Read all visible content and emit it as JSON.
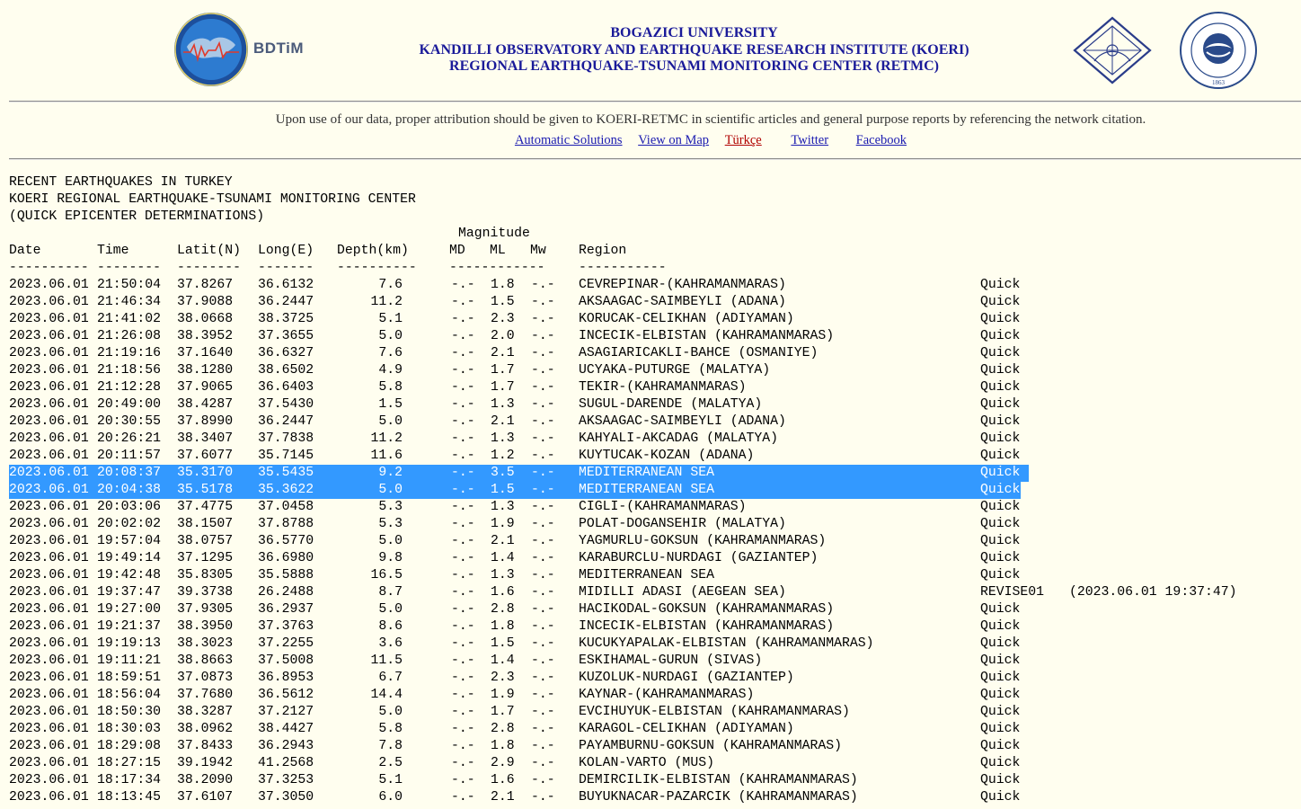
{
  "header": {
    "bdtim_label": "BDTiM",
    "title_line1": "BOGAZICI UNIVERSITY",
    "title_line2": "KANDILLI OBSERVATORY AND EARTHQUAKE RESEARCH INSTITUTE (KOERI)",
    "title_line3": "REGIONAL EARTHQUAKE-TSUNAMI MONITORING CENTER (RETMC)",
    "bu_logo_year": "1863"
  },
  "notice": "Upon use of our data, proper attribution should be given to KOERI-RETMC in scientific articles and general purpose reports by referencing the network citation.",
  "links": {
    "automatic": "Automatic Solutions",
    "map": "View on Map",
    "turkce": "Türkçe",
    "twitter": "Twitter",
    "facebook": "Facebook"
  },
  "listing": {
    "heading1": "RECENT EARTHQUAKES IN TURKEY",
    "heading2": "KOERI REGIONAL EARTHQUAKE-TSUNAMI MONITORING CENTER",
    "heading3": "(QUICK EPICENTER DETERMINATIONS)",
    "magnitude_label": "Magnitude",
    "columns": {
      "date": "Date",
      "time": "Time",
      "lat": "Latit(N)",
      "lon": "Long(E)",
      "depth": "Depth(km)",
      "md": "MD",
      "ml": "ML",
      "mw": "Mw",
      "region": "Region"
    },
    "dashes": {
      "date": "----------",
      "time": "--------",
      "lat": "--------",
      "lon": "-------",
      "depth": "----------",
      "mag": "------------",
      "region": "-----------"
    }
  },
  "rows": [
    {
      "date": "2023.06.01",
      "time": "21:50:04",
      "lat": "37.8267",
      "lon": "36.6132",
      "depth": "7.6",
      "md": "-.-",
      "ml": "1.8",
      "mw": "-.-",
      "region": "CEVREPINAR-(KAHRAMANMARAS)",
      "sol": "Quick",
      "note": "",
      "selected": false
    },
    {
      "date": "2023.06.01",
      "time": "21:46:34",
      "lat": "37.9088",
      "lon": "36.2447",
      "depth": "11.2",
      "md": "-.-",
      "ml": "1.5",
      "mw": "-.-",
      "region": "AKSAAGAC-SAIMBEYLI (ADANA)",
      "sol": "Quick",
      "note": "",
      "selected": false
    },
    {
      "date": "2023.06.01",
      "time": "21:41:02",
      "lat": "38.0668",
      "lon": "38.3725",
      "depth": "5.1",
      "md": "-.-",
      "ml": "2.3",
      "mw": "-.-",
      "region": "KORUCAK-CELIKHAN (ADIYAMAN)",
      "sol": "Quick",
      "note": "",
      "selected": false
    },
    {
      "date": "2023.06.01",
      "time": "21:26:08",
      "lat": "38.3952",
      "lon": "37.3655",
      "depth": "5.0",
      "md": "-.-",
      "ml": "2.0",
      "mw": "-.-",
      "region": "INCECIK-ELBISTAN (KAHRAMANMARAS)",
      "sol": "Quick",
      "note": "",
      "selected": false
    },
    {
      "date": "2023.06.01",
      "time": "21:19:16",
      "lat": "37.1640",
      "lon": "36.6327",
      "depth": "7.6",
      "md": "-.-",
      "ml": "2.1",
      "mw": "-.-",
      "region": "ASAGIARICAKLI-BAHCE (OSMANIYE)",
      "sol": "Quick",
      "note": "",
      "selected": false
    },
    {
      "date": "2023.06.01",
      "time": "21:18:56",
      "lat": "38.1280",
      "lon": "38.6502",
      "depth": "4.9",
      "md": "-.-",
      "ml": "1.7",
      "mw": "-.-",
      "region": "UCYAKA-PUTURGE (MALATYA)",
      "sol": "Quick",
      "note": "",
      "selected": false
    },
    {
      "date": "2023.06.01",
      "time": "21:12:28",
      "lat": "37.9065",
      "lon": "36.6403",
      "depth": "5.8",
      "md": "-.-",
      "ml": "1.7",
      "mw": "-.-",
      "region": "TEKIR-(KAHRAMANMARAS)",
      "sol": "Quick",
      "note": "",
      "selected": false
    },
    {
      "date": "2023.06.01",
      "time": "20:49:00",
      "lat": "38.4287",
      "lon": "37.5430",
      "depth": "1.5",
      "md": "-.-",
      "ml": "1.3",
      "mw": "-.-",
      "region": "SUGUL-DARENDE (MALATYA)",
      "sol": "Quick",
      "note": "",
      "selected": false
    },
    {
      "date": "2023.06.01",
      "time": "20:30:55",
      "lat": "37.8990",
      "lon": "36.2447",
      "depth": "5.0",
      "md": "-.-",
      "ml": "2.1",
      "mw": "-.-",
      "region": "AKSAAGAC-SAIMBEYLI (ADANA)",
      "sol": "Quick",
      "note": "",
      "selected": false
    },
    {
      "date": "2023.06.01",
      "time": "20:26:21",
      "lat": "38.3407",
      "lon": "37.7838",
      "depth": "11.2",
      "md": "-.-",
      "ml": "1.3",
      "mw": "-.-",
      "region": "KAHYALI-AKCADAG (MALATYA)",
      "sol": "Quick",
      "note": "",
      "selected": false
    },
    {
      "date": "2023.06.01",
      "time": "20:11:57",
      "lat": "37.6077",
      "lon": "35.7145",
      "depth": "11.6",
      "md": "-.-",
      "ml": "1.2",
      "mw": "-.-",
      "region": "KUYTUCAK-KOZAN (ADANA)",
      "sol": "Quick",
      "note": "",
      "selected": false
    },
    {
      "date": "2023.06.01",
      "time": "20:08:37",
      "lat": "35.3170",
      "lon": "35.5435",
      "depth": "9.2",
      "md": "-.-",
      "ml": "3.5",
      "mw": "-.-",
      "region": "MEDITERRANEAN SEA",
      "sol": "Quick",
      "note": "",
      "selected": true
    },
    {
      "date": "2023.06.01",
      "time": "20:04:38",
      "lat": "35.5178",
      "lon": "35.3622",
      "depth": "5.0",
      "md": "-.-",
      "ml": "1.5",
      "mw": "-.-",
      "region": "MEDITERRANEAN SEA",
      "sol": "Quick",
      "note": "",
      "selected": true
    },
    {
      "date": "2023.06.01",
      "time": "20:03:06",
      "lat": "37.4775",
      "lon": "37.0458",
      "depth": "5.3",
      "md": "-.-",
      "ml": "1.3",
      "mw": "-.-",
      "region": "CIGLI-(KAHRAMANMARAS)",
      "sol": "Quick",
      "note": "",
      "selected": false
    },
    {
      "date": "2023.06.01",
      "time": "20:02:02",
      "lat": "38.1507",
      "lon": "37.8788",
      "depth": "5.3",
      "md": "-.-",
      "ml": "1.9",
      "mw": "-.-",
      "region": "POLAT-DOGANSEHIR (MALATYA)",
      "sol": "Quick",
      "note": "",
      "selected": false
    },
    {
      "date": "2023.06.01",
      "time": "19:57:04",
      "lat": "38.0757",
      "lon": "36.5770",
      "depth": "5.0",
      "md": "-.-",
      "ml": "2.1",
      "mw": "-.-",
      "region": "YAGMURLU-GOKSUN (KAHRAMANMARAS)",
      "sol": "Quick",
      "note": "",
      "selected": false
    },
    {
      "date": "2023.06.01",
      "time": "19:49:14",
      "lat": "37.1295",
      "lon": "36.6980",
      "depth": "9.8",
      "md": "-.-",
      "ml": "1.4",
      "mw": "-.-",
      "region": "KARABURCLU-NURDAGI (GAZIANTEP)",
      "sol": "Quick",
      "note": "",
      "selected": false
    },
    {
      "date": "2023.06.01",
      "time": "19:42:48",
      "lat": "35.8305",
      "lon": "35.5888",
      "depth": "16.5",
      "md": "-.-",
      "ml": "1.3",
      "mw": "-.-",
      "region": "MEDITERRANEAN SEA",
      "sol": "Quick",
      "note": "",
      "selected": false
    },
    {
      "date": "2023.06.01",
      "time": "19:37:47",
      "lat": "39.3738",
      "lon": "26.2488",
      "depth": "8.7",
      "md": "-.-",
      "ml": "1.6",
      "mw": "-.-",
      "region": "MIDILLI ADASI (AEGEAN SEA)",
      "sol": "REVISE01",
      "note": "(2023.06.01 19:37:47)",
      "selected": false
    },
    {
      "date": "2023.06.01",
      "time": "19:27:00",
      "lat": "37.9305",
      "lon": "36.2937",
      "depth": "5.0",
      "md": "-.-",
      "ml": "2.8",
      "mw": "-.-",
      "region": "HACIKODAL-GOKSUN (KAHRAMANMARAS)",
      "sol": "Quick",
      "note": "",
      "selected": false
    },
    {
      "date": "2023.06.01",
      "time": "19:21:37",
      "lat": "38.3950",
      "lon": "37.3763",
      "depth": "8.6",
      "md": "-.-",
      "ml": "1.8",
      "mw": "-.-",
      "region": "INCECIK-ELBISTAN (KAHRAMANMARAS)",
      "sol": "Quick",
      "note": "",
      "selected": false
    },
    {
      "date": "2023.06.01",
      "time": "19:19:13",
      "lat": "38.3023",
      "lon": "37.2255",
      "depth": "3.6",
      "md": "-.-",
      "ml": "1.5",
      "mw": "-.-",
      "region": "KUCUKYAPALAK-ELBISTAN (KAHRAMANMARAS)",
      "sol": "Quick",
      "note": "",
      "selected": false
    },
    {
      "date": "2023.06.01",
      "time": "19:11:21",
      "lat": "38.8663",
      "lon": "37.5008",
      "depth": "11.5",
      "md": "-.-",
      "ml": "1.4",
      "mw": "-.-",
      "region": "ESKIHAMAL-GURUN (SIVAS)",
      "sol": "Quick",
      "note": "",
      "selected": false
    },
    {
      "date": "2023.06.01",
      "time": "18:59:51",
      "lat": "37.0873",
      "lon": "36.8953",
      "depth": "6.7",
      "md": "-.-",
      "ml": "2.3",
      "mw": "-.-",
      "region": "KUZOLUK-NURDAGI (GAZIANTEP)",
      "sol": "Quick",
      "note": "",
      "selected": false
    },
    {
      "date": "2023.06.01",
      "time": "18:56:04",
      "lat": "37.7680",
      "lon": "36.5612",
      "depth": "14.4",
      "md": "-.-",
      "ml": "1.9",
      "mw": "-.-",
      "region": "KAYNAR-(KAHRAMANMARAS)",
      "sol": "Quick",
      "note": "",
      "selected": false
    },
    {
      "date": "2023.06.01",
      "time": "18:50:30",
      "lat": "38.3287",
      "lon": "37.2127",
      "depth": "5.0",
      "md": "-.-",
      "ml": "1.7",
      "mw": "-.-",
      "region": "EVCIHUYUK-ELBISTAN (KAHRAMANMARAS)",
      "sol": "Quick",
      "note": "",
      "selected": false
    },
    {
      "date": "2023.06.01",
      "time": "18:30:03",
      "lat": "38.0962",
      "lon": "38.4427",
      "depth": "5.8",
      "md": "-.-",
      "ml": "2.8",
      "mw": "-.-",
      "region": "KARAGOL-CELIKHAN (ADIYAMAN)",
      "sol": "Quick",
      "note": "",
      "selected": false
    },
    {
      "date": "2023.06.01",
      "time": "18:29:08",
      "lat": "37.8433",
      "lon": "36.2943",
      "depth": "7.8",
      "md": "-.-",
      "ml": "1.8",
      "mw": "-.-",
      "region": "PAYAMBURNU-GOKSUN (KAHRAMANMARAS)",
      "sol": "Quick",
      "note": "",
      "selected": false
    },
    {
      "date": "2023.06.01",
      "time": "18:27:15",
      "lat": "39.1942",
      "lon": "41.2568",
      "depth": "2.5",
      "md": "-.-",
      "ml": "2.9",
      "mw": "-.-",
      "region": "KOLAN-VARTO (MUS)",
      "sol": "Quick",
      "note": "",
      "selected": false
    },
    {
      "date": "2023.06.01",
      "time": "18:17:34",
      "lat": "38.2090",
      "lon": "37.3253",
      "depth": "5.1",
      "md": "-.-",
      "ml": "1.6",
      "mw": "-.-",
      "region": "DEMIRCILIK-ELBISTAN (KAHRAMANMARAS)",
      "sol": "Quick",
      "note": "",
      "selected": false
    },
    {
      "date": "2023.06.01",
      "time": "18:13:45",
      "lat": "37.6107",
      "lon": "37.3050",
      "depth": "6.0",
      "md": "-.-",
      "ml": "2.1",
      "mw": "-.-",
      "region": "BUYUKNACAR-PAZARCIK (KAHRAMANMARAS)",
      "sol": "Quick",
      "note": "",
      "selected": false
    }
  ]
}
